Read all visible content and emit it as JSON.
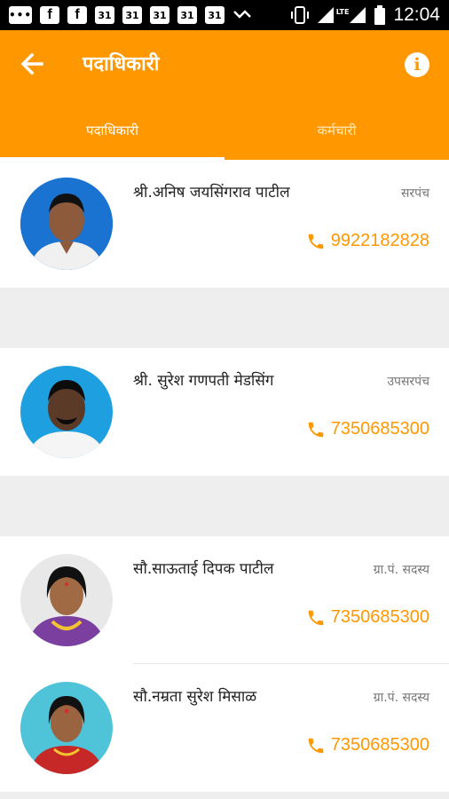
{
  "statusbar": {
    "time": "12:04",
    "notification_icons": [
      "message-icon",
      "facebook-icon",
      "facebook-icon",
      "calendar-icon",
      "calendar-icon",
      "calendar-icon",
      "calendar-icon",
      "calendar-icon",
      "missed-call-icon"
    ],
    "calendar_day": "31",
    "fb_glyph": "f",
    "lte": "LTE"
  },
  "appbar": {
    "title": "पदाधिकारी",
    "back_icon": "arrow-left-icon",
    "info_icon": "info-icon",
    "color": "#ff9800"
  },
  "tabs": [
    {
      "label": "पदाधिकारी",
      "active": true
    },
    {
      "label": "कर्मचारी",
      "active": false
    }
  ],
  "members": [
    {
      "name": "श्री.अनिष जयसिंगराव पाटील",
      "role": "सरपंच",
      "phone": "9922182828"
    },
    {
      "name": "श्री. सुरेश गणपती मेडसिंग",
      "role": "उपसरपंच",
      "phone": "7350685300"
    },
    {
      "name": "सौ.साऊताई दिपक पाटील",
      "role": "ग्रा.पं. सदस्य",
      "phone": "7350685300"
    },
    {
      "name": "सौ.नम्रता सुरेश मिसाळ",
      "role": "ग्रा.पं. सदस्य",
      "phone": "7350685300"
    }
  ]
}
